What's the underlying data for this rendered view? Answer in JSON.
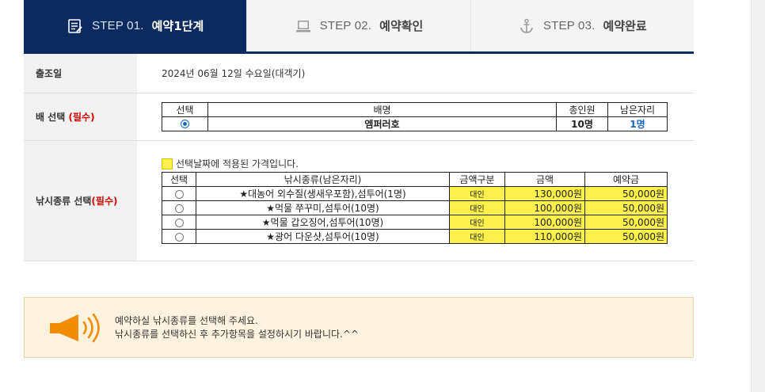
{
  "steps": [
    {
      "prefix": "STEP 01.",
      "name": "예약1단계",
      "icon": "form-list-icon",
      "active": true
    },
    {
      "prefix": "STEP 02.",
      "name": "예약확인",
      "icon": "laptop-icon",
      "active": false
    },
    {
      "prefix": "STEP 03.",
      "name": "예약완료",
      "icon": "anchor-icon",
      "active": false
    }
  ],
  "departure": {
    "label": "출조일",
    "value": "2024년 06월 12일 수요일(대객기)"
  },
  "boat": {
    "label": "배 선택",
    "required": "(필수)",
    "headers": {
      "select": "선택",
      "name": "배명",
      "total": "총인원",
      "remaining": "남은자리"
    },
    "row": {
      "name": "엠퍼러호",
      "total": "10명",
      "remaining": "1명",
      "selected": true
    }
  },
  "fishing": {
    "label": "낚시종류 선택",
    "required": "(필수)",
    "note": "선택날짜에 적용된 가격입니다.",
    "headers": {
      "select": "선택",
      "type": "낚시종류(남은자리)",
      "category": "금액구분",
      "price": "금액",
      "deposit": "예약금"
    },
    "rows": [
      {
        "type": "★대농어 외수질(생새우포함),섬투어(1명)",
        "category": "대인",
        "price": "130,000원",
        "deposit": "50,000원"
      },
      {
        "type": "★먹물 쭈꾸미,섬투어(10명)",
        "category": "대인",
        "price": "100,000원",
        "deposit": "50,000원"
      },
      {
        "type": "★먹물 갑오징어,섬투어(10명)",
        "category": "대인",
        "price": "100,000원",
        "deposit": "50,000원"
      },
      {
        "type": "★광어 다운샷,섬투어(10명)",
        "category": "대인",
        "price": "110,000원",
        "deposit": "50,000원"
      }
    ]
  },
  "notice": {
    "line1": "예약하실 낚시종류를 선택해 주세요.",
    "line2": "낚시종류를 선택하신 후 추가항목을 설정하시기 바랍니다.^^",
    "icon": "megaphone-icon"
  },
  "colors": {
    "navy": "#0b2a5e",
    "highlight": "#fbf04c",
    "required": "#d40000",
    "accent_blue": "#1a63c8",
    "notice_bg": "#fff3df"
  }
}
